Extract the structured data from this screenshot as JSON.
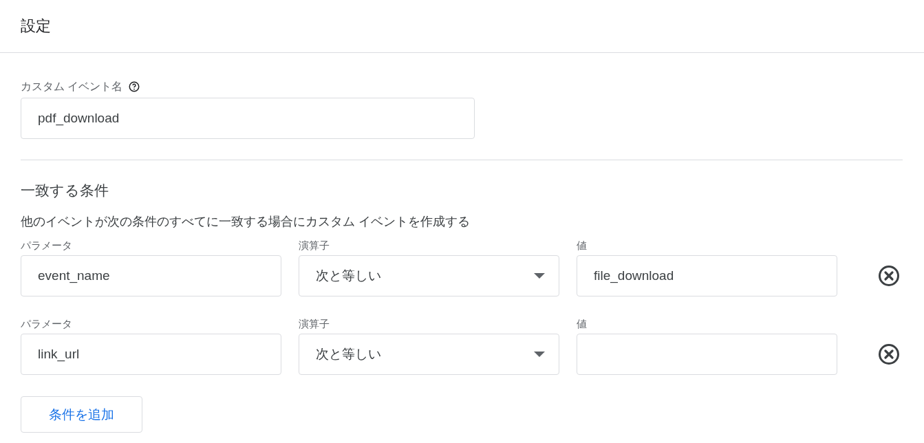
{
  "header": {
    "title": "設定"
  },
  "event_name": {
    "label": "カスタム イベント名",
    "value": "pdf_download"
  },
  "conditions": {
    "title": "一致する条件",
    "description": "他のイベントが次の条件のすべてに一致する場合にカスタム イベントを作成する",
    "rows": [
      {
        "parameter_label": "パラメータ",
        "parameter": "event_name",
        "operator_label": "演算子",
        "operator": "次と等しい",
        "value_label": "値",
        "value": "file_download"
      },
      {
        "parameter_label": "パラメータ",
        "parameter": "link_url",
        "operator_label": "演算子",
        "operator": "次と等しい",
        "value_label": "値"
      }
    ],
    "add_button": "条件を追加"
  }
}
